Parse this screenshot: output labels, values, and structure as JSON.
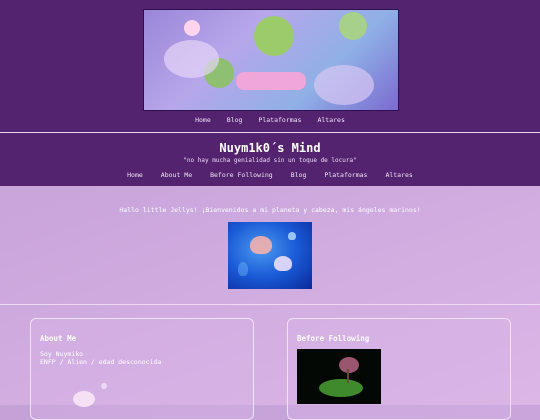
{
  "header": {
    "nav_top": [
      "Home",
      "Blog",
      "Plataformas",
      "Altares"
    ],
    "site_title": "Nuym1k0´s Mind",
    "tagline": "\"no hay mucha genialidad sin un toque de locura\"",
    "nav_main": [
      "Home",
      "About Me",
      "Before Following",
      "Blog",
      "Plataformas",
      "Altares"
    ]
  },
  "main": {
    "welcome": "Hallo little Jellys! ¡Bienvenidos a mi planeta y cabeza, mis ángeles marinos!"
  },
  "cards": {
    "about": {
      "title": "About Me",
      "line1": "Soy Nuymiko",
      "line2": "ENFP / Alien / edad desconocida"
    },
    "before_following": {
      "title": "Before Following"
    }
  },
  "colors": {
    "header_bg": "#53236f",
    "page_gradient_start": "#c4a2d8",
    "page_gradient_end": "#dcb6e6",
    "text": "#ffffff"
  }
}
